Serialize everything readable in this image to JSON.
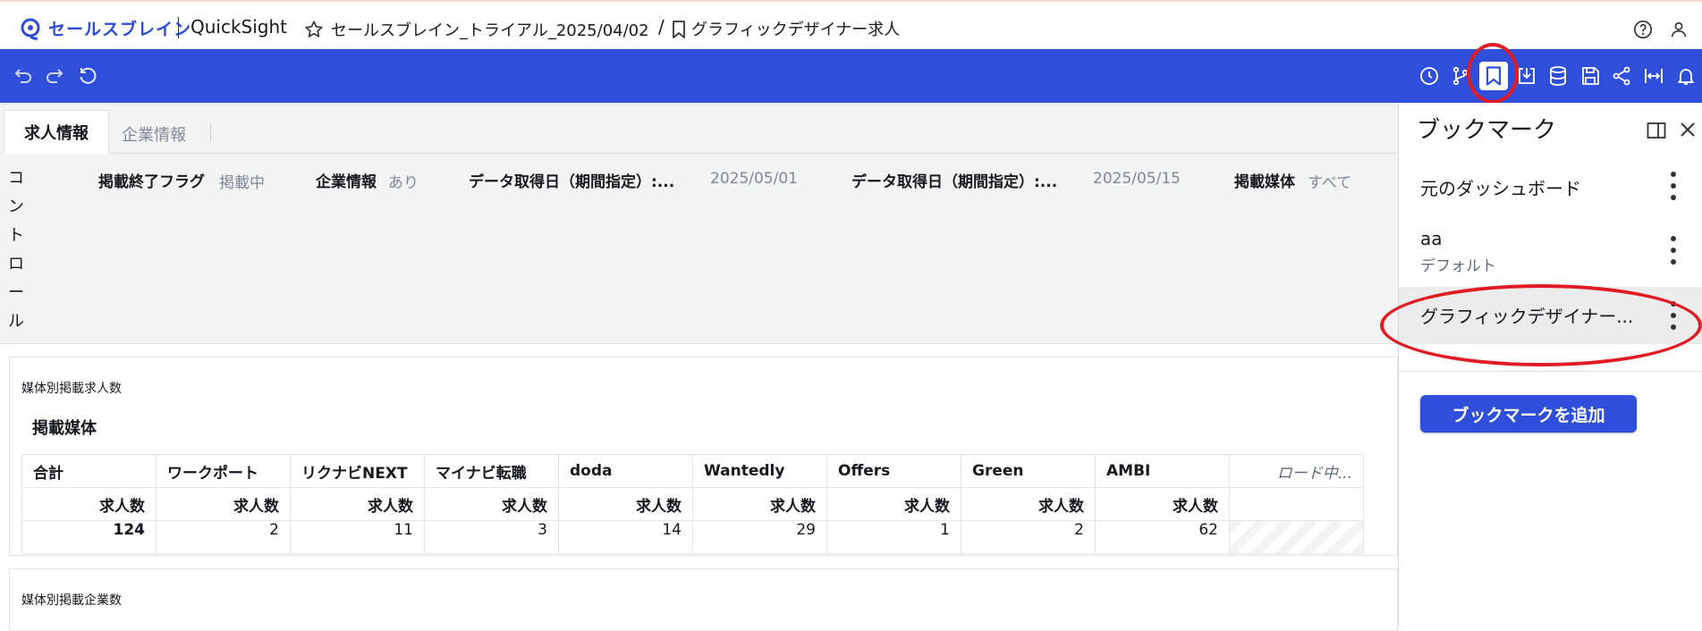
{
  "header": {
    "logo_text": "セールスブレイン",
    "app_name": "QuickSight",
    "dashboard_name": "セールスブレイン_トライアル_2025/04/02",
    "separator": "/",
    "bookmark_name": "グラフィックデザイナー求人"
  },
  "toolbar": {
    "left_icons": [
      "undo-icon",
      "redo-icon",
      "reset-icon"
    ],
    "right_icons": [
      "schedule-icon",
      "threshold-alert-icon",
      "bookmark-icon",
      "download-icon",
      "dataset-icon",
      "save-icon",
      "share-icon",
      "fit-width-icon",
      "notification-icon"
    ]
  },
  "tabs": [
    {
      "label": "求人情報",
      "active": true
    },
    {
      "label": "企業情報",
      "active": false
    }
  ],
  "controls": {
    "section_label": [
      "コ",
      "ン",
      "ト",
      "ロ",
      "ー",
      "ル"
    ],
    "items": [
      {
        "label": "掲載終了フラグ",
        "value": "掲載中"
      },
      {
        "label": "企業情報",
        "value": "あり"
      },
      {
        "label": "データ取得日（期間指定）:...",
        "value": "2025/05/01"
      },
      {
        "label": "データ取得日（期間指定）:...",
        "value": "2025/05/15"
      },
      {
        "label": "掲載媒体",
        "value": "すべて"
      }
    ]
  },
  "visual1": {
    "title": "媒体別掲載求人数",
    "row_header": "掲載媒体",
    "columns": [
      "合計",
      "ワークポート",
      "リクナビNEXT",
      "マイナビ転職",
      "doda",
      "Wantedly",
      "Offers",
      "Green",
      "AMBI",
      "ロード中..."
    ],
    "metric_label": "求人数",
    "values": [
      "124",
      "2",
      "11",
      "3",
      "14",
      "29",
      "1",
      "2",
      "62"
    ]
  },
  "visual2": {
    "title": "媒体別掲載企業数"
  },
  "bookmark_panel": {
    "title": "ブックマーク",
    "items": [
      {
        "name": "元のダッシュボード",
        "subtitle": ""
      },
      {
        "name": "aa",
        "subtitle": "デフォルト"
      },
      {
        "name": "グラフィックデザイナー...",
        "subtitle": "",
        "selected": true
      }
    ],
    "add_button": "ブックマークを追加"
  },
  "colors": {
    "toolbar_blue": "#2f4fdb",
    "annotation_red": "#e01b24"
  }
}
